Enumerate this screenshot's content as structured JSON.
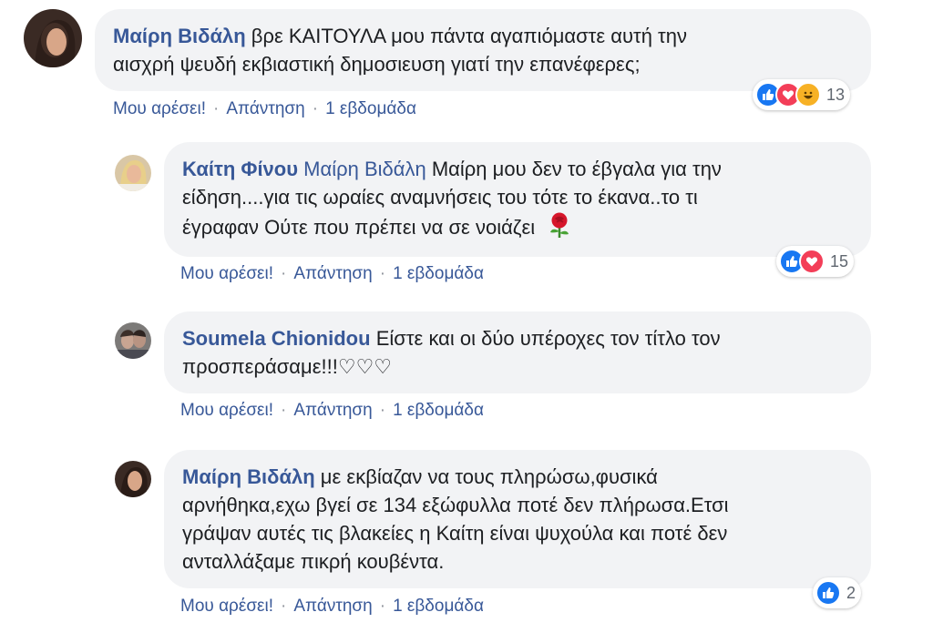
{
  "comments": [
    {
      "author": "Μαίρη Βιδάλη",
      "mention": "",
      "text_lines": [
        "βρε ΚΑΙΤΟΥΛΑ μου πάντα αγαπιόμαστε αυτή την",
        "αισχρή ψευδή εκβιαστική δημοσιευση γιατί την επανέφερες;"
      ],
      "like_label": "Μου αρέσει!",
      "reply_label": "Απάντηση",
      "time": "1 εβδομάδα",
      "reaction_icons": [
        "like-icon",
        "love-icon",
        "haha-icon"
      ],
      "reaction_count": "13"
    },
    {
      "author": "Καίτη Φίνου",
      "mention": "Μαίρη Βιδάλη",
      "text_lines": [
        "Μαίρη μου δεν το έβγαλα για την",
        "είδηση....για τις ωραίες αναμνήσεις του τότε το έκανα..το τι",
        "έγραφαν Ούτε που πρέπει να σε νοιάζει"
      ],
      "emoji": "rose-icon",
      "like_label": "Μου αρέσει!",
      "reply_label": "Απάντηση",
      "time": "1 εβδομάδα",
      "reaction_icons": [
        "like-icon",
        "love-icon"
      ],
      "reaction_count": "15"
    },
    {
      "author": "Soumela Chionidou",
      "mention": "",
      "text_lines": [
        "Είστε και οι δύο υπέροχες τον τίτλο τον",
        "προσπεράσαμε!!!♡♡♡"
      ],
      "like_label": "Μου αρέσει!",
      "reply_label": "Απάντηση",
      "time": "1 εβδομάδα"
    },
    {
      "author": "Μαίρη Βιδάλη",
      "mention": "",
      "text_lines": [
        "με εκβίαζαν να τους πληρώσω,φυσικά",
        "αρνήθηκα,εχω βγεί σε 134 εξώφυλλα ποτέ δεν πλήρωσα.Ετσι",
        "γράψαν αυτές τις βλακείες η Καίτη είναι ψυχούλα και ποτέ δεν",
        "ανταλλάξαμε πικρή κουβέντα."
      ],
      "like_label": "Μου αρέσει!",
      "reply_label": "Απάντηση",
      "time": "1 εβδομάδα",
      "reaction_icons": [
        "like-icon"
      ],
      "reaction_count": "2"
    }
  ],
  "colors": {
    "author": "#385898",
    "bubble": "#f2f3f5",
    "like": "#1877f2",
    "love": "#f33e58",
    "haha": "#f7b125"
  }
}
